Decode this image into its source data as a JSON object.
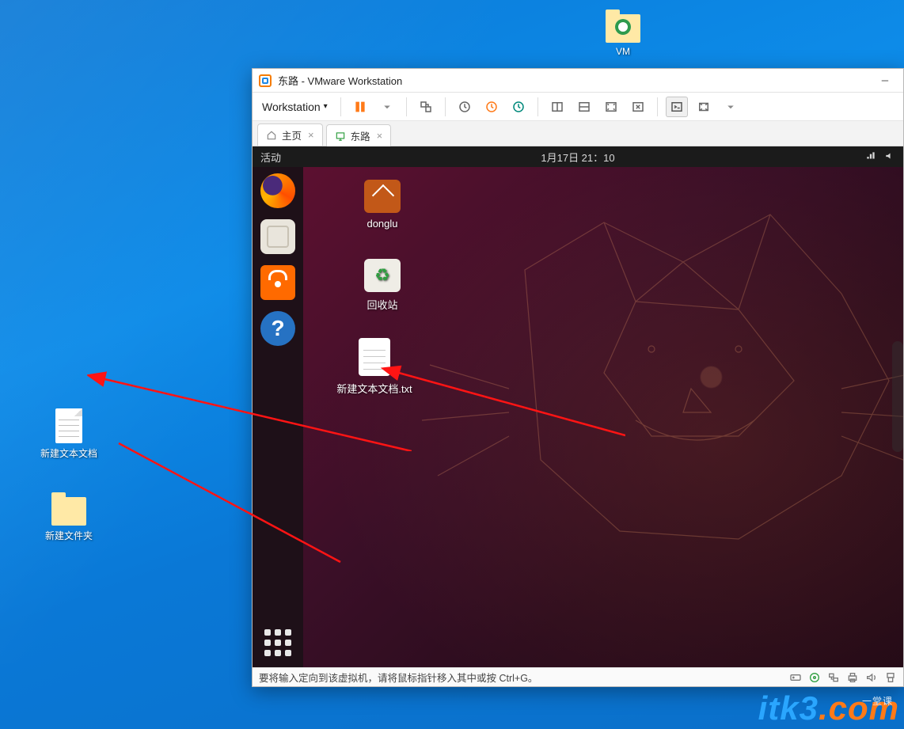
{
  "host_desktop": {
    "icons": {
      "vm_folder": "VM",
      "text_doc": "新建文本文档",
      "new_folder": "新建文件夹"
    }
  },
  "watermark": {
    "brand_a": "itk3",
    "brand_b": ".com",
    "tag": "一堂课"
  },
  "vmware": {
    "title": "东路 - VMware Workstation",
    "menu_label": "Workstation",
    "tabs": {
      "home": "主页",
      "vm": "东路"
    },
    "status_hint": "要将输入定向到该虚拟机，请将鼠标指针移入其中或按 Ctrl+G。"
  },
  "ubuntu": {
    "activities": "活动",
    "clock": "1月17日 21：10",
    "desktop_icons": {
      "home": "donglu",
      "trash": "回收站",
      "txt": "新建文本文档.txt"
    },
    "help_glyph": "?"
  }
}
